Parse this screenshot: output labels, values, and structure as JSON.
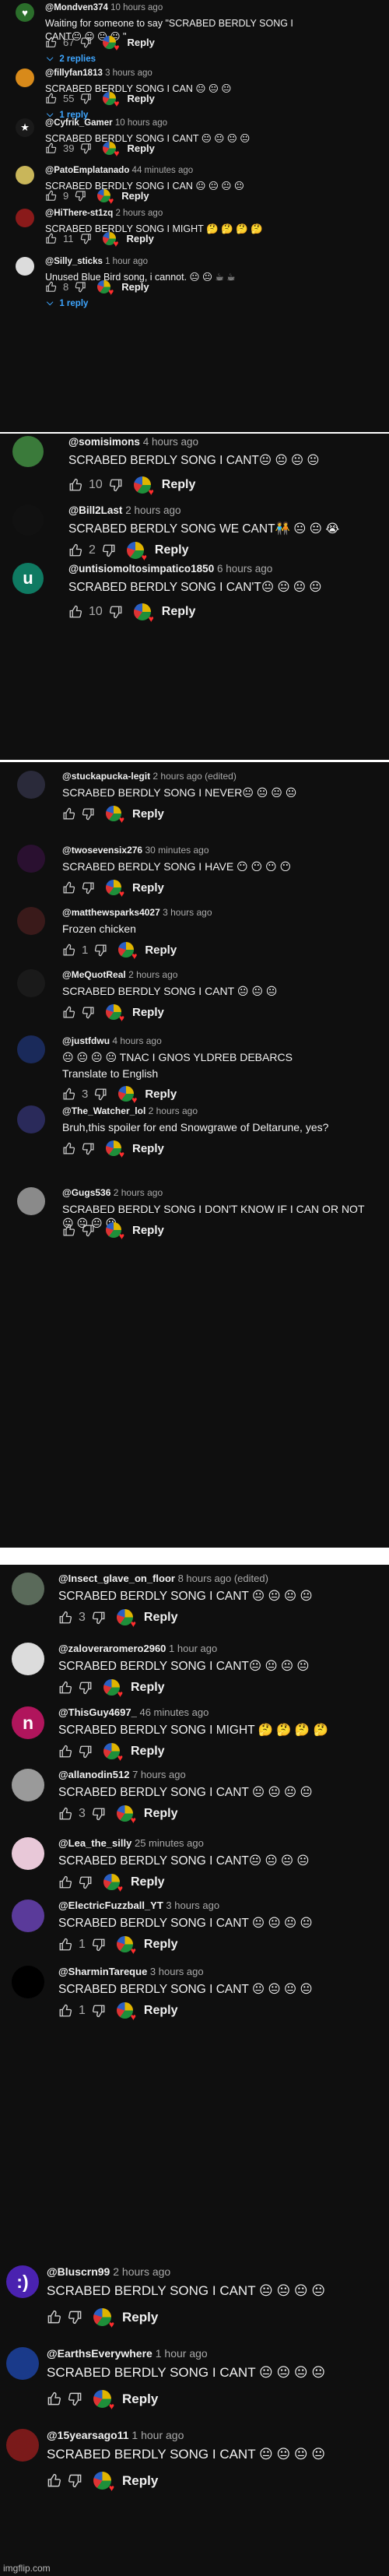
{
  "sections": [
    {
      "comments": [
        {
          "author": "@Mondven374",
          "time": "10 hours ago",
          "text": "Waiting for someone to say \"SCRABED BERDLY SONG I CANT😐 😐 😐 😐 \"",
          "likes": "67",
          "replies": "2 replies",
          "avatar_color": "#2b6e2b",
          "avatar_char": "♥"
        },
        {
          "author": "@fillyfan1813",
          "time": "3 hours ago",
          "text": "SCRABED BERDLY SONG I CAN 😐 😐 😐",
          "likes": "55",
          "replies": "1 reply",
          "avatar_color": "#d88a1a",
          "avatar_char": ""
        },
        {
          "author": "@Cyfrik_Gamer",
          "time": "10 hours ago",
          "text": "SCRABED BERDLY SONG I CANT 😐 😐 😐 😐",
          "likes": "39",
          "avatar_color": "#1a1a1a",
          "avatar_char": "★"
        },
        {
          "author": "@PatoEmplatanado",
          "time": "44 minutes ago",
          "text": "SCRABED BERDLY SONG I CAN 😐 😐 😐 😐",
          "likes": "9",
          "avatar_color": "#c9b65a",
          "avatar_char": ""
        },
        {
          "author": "@HiThere-st1zq",
          "time": "2 hours ago",
          "text": "SCRABED BERDLY SONG I MIGHT 🤔 🤔 🤔 🤔",
          "likes": "11",
          "avatar_color": "#8a1a1a",
          "avatar_char": ""
        },
        {
          "author": "@Silly_sticks",
          "time": "1 hour ago",
          "text": "Unused Blue Bird song, i cannot. 😐 😐 ☕ ☕",
          "likes": "8",
          "replies": "1 reply",
          "avatar_color": "#dcdcdc",
          "avatar_char": ""
        }
      ]
    },
    {
      "comments": [
        {
          "author": "@somisimons",
          "time": "4 hours ago",
          "text": "SCRABED BERDLY SONG I CANT😐 😐 😐 😐",
          "likes": "10",
          "avatar_color": "#3a7a3a",
          "avatar_char": ""
        },
        {
          "author": "@Bill2Last",
          "time": "2 hours ago",
          "text": "SCRABED BERDLY SONG WE CANT🧑‍🤝‍🧑 😐 😐 😭",
          "likes": "2",
          "avatar_color": "#111111",
          "avatar_char": ""
        },
        {
          "author": "@untisiomoltosimpatico1850",
          "time": "6 hours ago",
          "text": "SCRABED BERDLY SONG I CAN'T😐 😐 😐 😐",
          "likes": "10",
          "avatar_color": "#0f7a62",
          "avatar_char": "u"
        }
      ]
    },
    {
      "comments": [
        {
          "author": "@stuckapucka-legit",
          "time": "2 hours ago (edited)",
          "text": "SCRABED BERDLY SONG I NEVER😐 😐 😐 😐",
          "avatar_color": "#2a2a3a",
          "avatar_char": ""
        },
        {
          "author": "@twosevensix276",
          "time": "30 minutes ago",
          "text": "SCRABED BERDLY SONG I HAVE 😶 😶 😶 😶",
          "avatar_color": "#2a1030",
          "avatar_char": ""
        },
        {
          "author": "@matthewsparks4027",
          "time": "3 hours ago",
          "text": "Frozen chicken",
          "likes": "1",
          "avatar_color": "#3a1a1a",
          "avatar_char": ""
        },
        {
          "author": "@MeQuotReal",
          "time": "2 hours ago",
          "text": "SCRABED BERDLY SONG I CANT 😐 😐 😐",
          "avatar_color": "#1a1a1a",
          "avatar_char": ""
        },
        {
          "author": "@justfdwu",
          "time": "4 hours ago",
          "text": "😐 😐 😐 😐 TNAC I GNOS YLDREB DEBARCS",
          "translate": "Translate to English",
          "likes": "3",
          "avatar_color": "#1a2a5a",
          "avatar_char": ""
        },
        {
          "author": "@The_Watcher_lol",
          "time": "2 hours ago",
          "text": "Bruh,this spoiler for end Snowgrawe of Deltarune, yes?",
          "avatar_color": "#2a2a5a",
          "avatar_char": ""
        },
        {
          "author": "@Gugs536",
          "time": "2 hours ago",
          "text": "SCRABED BERDLY SONG I DON'T KNOW IF I CAN OR NOT😐 😐 😐 😐",
          "avatar_color": "#8a8a8a",
          "avatar_char": ""
        }
      ]
    },
    {
      "comments": [
        {
          "author": "@Insect_glave_on_floor",
          "time": "8 hours ago (edited)",
          "text": "SCRABED BERDLY SONG I CANT 😐 😐 😐 😐",
          "likes": "3",
          "avatar_color": "#5a6a5a",
          "avatar_char": ""
        },
        {
          "author": "@zaloveraromero2960",
          "time": "1 hour ago",
          "text": "SCRABED BERDLY SONG I CANT😐 😐 😐 😐",
          "avatar_color": "#dcdcdc",
          "avatar_char": ""
        },
        {
          "author": "@ThisGuy4697_",
          "time": "46 minutes ago",
          "text": "SCRABED BERDLY SONG I MIGHT 🤔 🤔 🤔 🤔",
          "avatar_color": "#b0155c",
          "avatar_char": "n"
        },
        {
          "author": "@allanodin512",
          "time": "7 hours ago",
          "text": "SCRABED BERDLY SONG I CANT 😐 😐 😐 😐",
          "likes": "3",
          "avatar_color": "#9a9a9a",
          "avatar_char": ""
        },
        {
          "author": "@Lea_the_silly",
          "time": "25 minutes ago",
          "text": "SCRABED BERDLY SONG I CANT😐 😐 😐 😐",
          "avatar_color": "#e8c8d8",
          "avatar_char": ""
        },
        {
          "author": "@ElectricFuzzball_YT",
          "time": "3 hours ago",
          "text": "SCRABED BERDLY SONG I CANT 😐 😐 😐 😐",
          "likes": "1",
          "avatar_color": "#5a3a9a",
          "avatar_char": ""
        },
        {
          "author": "@SharminTareque",
          "time": "3 hours ago",
          "text": "SCRABED BERDLY SONG I CANT 😐 😐 😐 😐",
          "likes": "1",
          "avatar_color": "#000000",
          "avatar_char": ""
        }
      ]
    },
    {
      "comments": [
        {
          "author": "@Bluscrn99",
          "time": "2 hours ago",
          "text": "SCRABED BERDLY SONG I CANT 😐 😐 😐 😐",
          "avatar_color": "#4a22b0",
          "avatar_char": ":)"
        },
        {
          "author": "@EarthsEverywhere",
          "time": "1 hour ago",
          "text": "SCRABED BERDLY SONG I CANT 😐 😐 😐 😐",
          "avatar_color": "#1a3a8a",
          "avatar_char": ""
        },
        {
          "author": "@15yearsago11",
          "time": "1 hour ago",
          "text": "SCRABED BERDLY SONG I CANT 😐 😐 😐 😐",
          "avatar_color": "#7a1a1a",
          "avatar_char": ""
        }
      ]
    }
  ],
  "labels": {
    "reply": "Reply"
  },
  "watermark": "imgflip.com",
  "colors": {
    "background": "#0f0f0f",
    "link": "#3ea6ff",
    "muted": "#aaaaaa",
    "heart": "#ff2d2d",
    "divider": "#ffffff"
  }
}
